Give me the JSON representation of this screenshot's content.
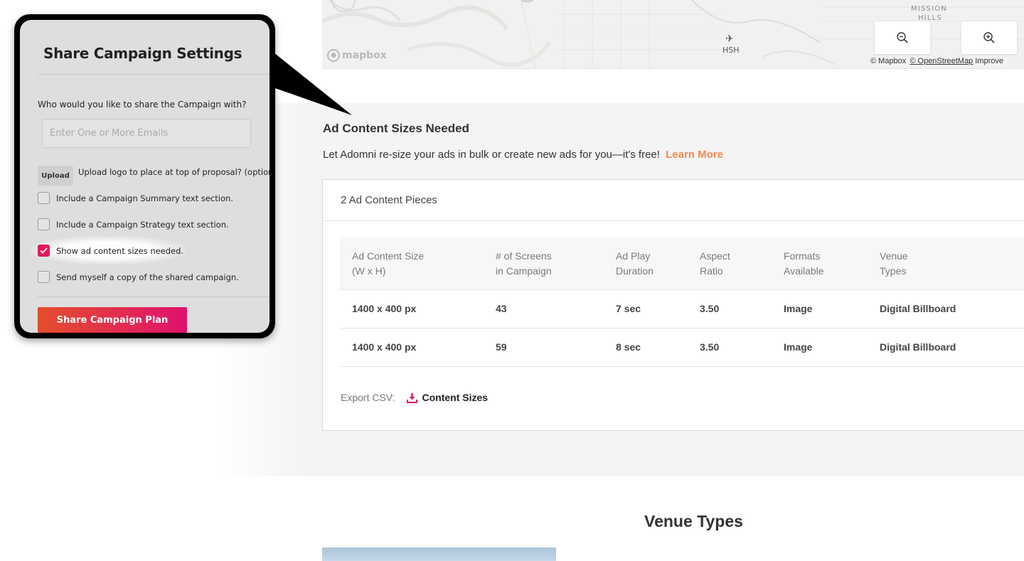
{
  "map": {
    "label_mission": "MISSION",
    "label_hills": "HILLS",
    "airport_code": "HSH",
    "mapbox_logo": "mapbox",
    "zoom_out_icon": "zoom-out-icon",
    "zoom_in_icon": "zoom-in-icon",
    "attribution_mapbox": "© Mapbox",
    "attribution_osm": "© OpenStreetMap",
    "attribution_improve": "Improve"
  },
  "ad_sizes": {
    "title": "Ad Content Sizes Needed",
    "description": "Let Adomni re-size your ads in bulk or create new ads for you—it's free!",
    "learn_more": "Learn More",
    "card_header": "2 Ad Content Pieces",
    "columns": [
      {
        "line1": "Ad Content Size",
        "line2": "(W x H)"
      },
      {
        "line1": "# of Screens",
        "line2": "in Campaign"
      },
      {
        "line1": "Ad Play",
        "line2": "Duration"
      },
      {
        "line1": "Aspect",
        "line2": "Ratio"
      },
      {
        "line1": "Formats",
        "line2": "Available"
      },
      {
        "line1": "Venue",
        "line2": "Types"
      }
    ],
    "rows": [
      [
        "1400 x 400 px",
        "43",
        "7 sec",
        "3.50",
        "Image",
        "Digital Billboard"
      ],
      [
        "1400 x 400 px",
        "59",
        "8 sec",
        "3.50",
        "Image",
        "Digital Billboard"
      ]
    ],
    "export_label": "Export CSV:",
    "export_link": "Content Sizes"
  },
  "venue_types": {
    "title": "Venue Types"
  },
  "modal": {
    "title": "Share Campaign Settings",
    "question": "Who would you like to share the Campaign with?",
    "email_placeholder": "Enter One or More Emails",
    "upload_button": "Upload",
    "upload_text": "Upload logo to place at top of proposal? (optional)",
    "options": [
      {
        "label": "Include a Campaign Summary text section.",
        "checked": false
      },
      {
        "label": "Include a Campaign Strategy text section.",
        "checked": false
      },
      {
        "label": "Show ad content sizes needed.",
        "checked": true
      },
      {
        "label": "Send myself a copy of the shared campaign.",
        "checked": false
      }
    ],
    "share_button": "Share Campaign Plan"
  },
  "colors": {
    "accent_orange": "#f0894a",
    "checkbox_pink": "#e2185c",
    "button_gradient_start": "#e44e2c",
    "button_gradient_end": "#e0116e"
  }
}
